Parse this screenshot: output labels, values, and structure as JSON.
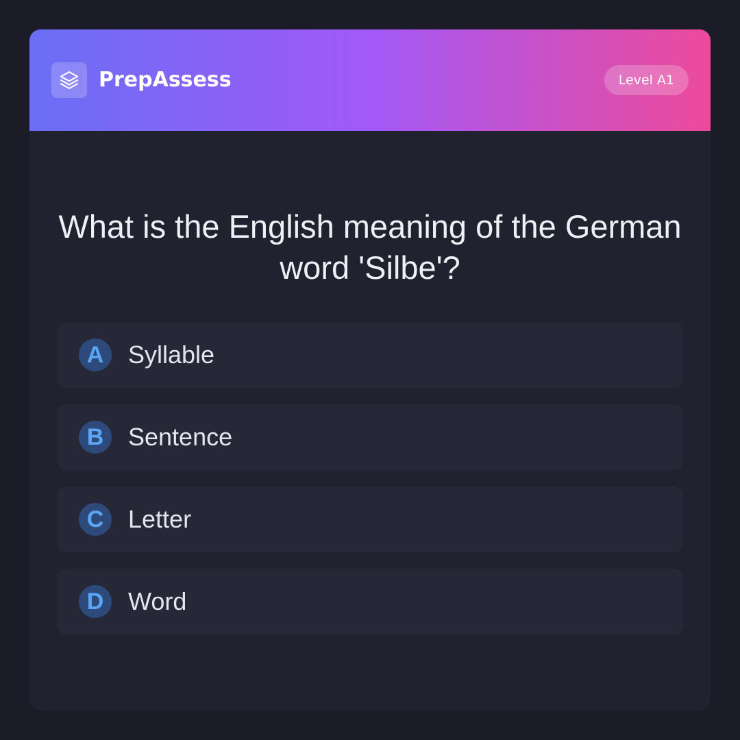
{
  "header": {
    "brand": "PrepAssess",
    "logo_icon": "layers-icon",
    "level_badge": "Level A1",
    "gradient": [
      "#6a6ef5",
      "#a259f7",
      "#ed4a9a"
    ]
  },
  "question": {
    "text": "What is the English meaning of the German word 'Silbe'?"
  },
  "options": [
    {
      "letter": "A",
      "label": "Syllable"
    },
    {
      "letter": "B",
      "label": "Sentence"
    },
    {
      "letter": "C",
      "label": "Letter"
    },
    {
      "letter": "D",
      "label": "Word"
    }
  ],
  "colors": {
    "background": "#1b1c27",
    "card": "#20222f",
    "option_bg": "#262837",
    "letter_badge": "#2e4a7a",
    "letter_text": "#5aa6f6"
  }
}
